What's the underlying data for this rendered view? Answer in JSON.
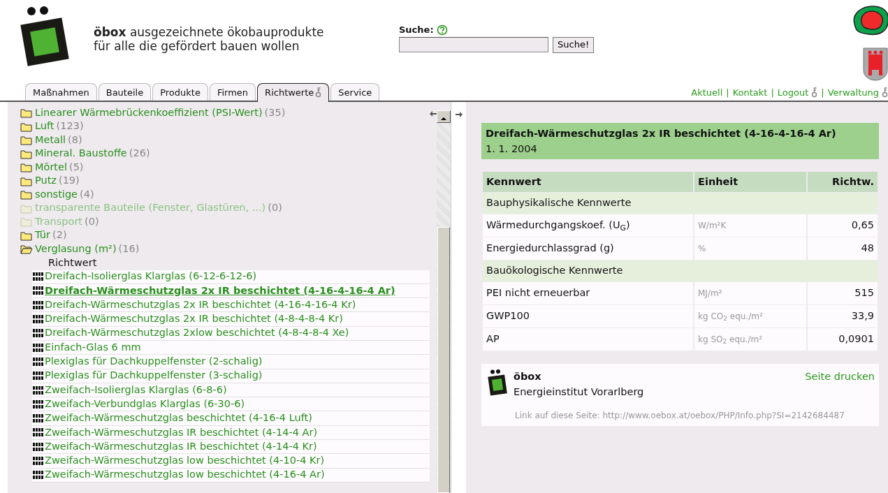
{
  "header": {
    "brand": "öbox",
    "tagline": "ausgezeichnete ökobauprodukte",
    "tagline_2": "für alle die gefördert bauen wollen"
  },
  "search": {
    "label": "Suche:",
    "button": "Suche!"
  },
  "tabs": [
    {
      "label": "Maßnahmen",
      "selected": false,
      "locked": false
    },
    {
      "label": "Bauteile",
      "selected": false,
      "locked": false
    },
    {
      "label": "Produkte",
      "selected": false,
      "locked": false
    },
    {
      "label": "Firmen",
      "selected": false,
      "locked": false
    },
    {
      "label": "Richtwerte",
      "selected": true,
      "locked": true
    },
    {
      "label": "Service",
      "selected": false,
      "locked": false
    }
  ],
  "top_links": {
    "separator": "|",
    "items": [
      {
        "label": "Aktuell",
        "locked": false
      },
      {
        "label": "Kontakt",
        "locked": false
      },
      {
        "label": "Logout",
        "locked": true
      },
      {
        "label": "Verwaltung",
        "locked": true
      }
    ]
  },
  "tree": [
    {
      "label": "Linearer Wärmebrückenkoeffizient (PSI-Wert)",
      "count": "(35)",
      "empty": false,
      "expanded": false
    },
    {
      "label": "Luft",
      "count": "(123)",
      "empty": false,
      "expanded": false
    },
    {
      "label": "Metall",
      "count": "(8)",
      "empty": false,
      "expanded": false
    },
    {
      "label": "Mineral. Baustoffe",
      "count": "(26)",
      "empty": false,
      "expanded": false
    },
    {
      "label": "Mörtel",
      "count": "(5)",
      "empty": false,
      "expanded": false
    },
    {
      "label": "Putz",
      "count": "(19)",
      "empty": false,
      "expanded": false
    },
    {
      "label": "sonstige",
      "count": "(4)",
      "empty": false,
      "expanded": false
    },
    {
      "label": "transparente Bauteile (Fenster, Glastüren, ...)",
      "count": "(0)",
      "empty": true,
      "expanded": false
    },
    {
      "label": "Transport",
      "count": "(0)",
      "empty": true,
      "expanded": false
    },
    {
      "label": "Tür",
      "count": "(2)",
      "empty": false,
      "expanded": false
    },
    {
      "label": "Verglasung (m²)",
      "count": "(16)",
      "empty": false,
      "expanded": true,
      "children_heading": "Richtwert",
      "children": [
        {
          "label": "Dreifach-Isolierglas Klarglas (6-12-6-12-6)",
          "selected": false
        },
        {
          "label": "Dreifach-Wärmeschutzglas 2x IR beschichtet (4-16-4-16-4 Ar)",
          "selected": true
        },
        {
          "label": "Dreifach-Wärmeschutzglas 2x IR beschichtet (4-16-4-16-4 Kr)",
          "selected": false
        },
        {
          "label": "Dreifach-Wärmeschutzglas 2x IR beschichtet (4-8-4-8-4 Kr)",
          "selected": false
        },
        {
          "label": "Dreifach-Wärmeschutzglas 2xlow beschichtet (4-8-4-8-4 Xe)",
          "selected": false
        },
        {
          "label": "Einfach-Glas 6 mm",
          "selected": false
        },
        {
          "label": "Plexiglas für Dachkuppelfenster (2-schalig)",
          "selected": false
        },
        {
          "label": "Plexiglas für Dachkuppelfenster (3-schalig)",
          "selected": false
        },
        {
          "label": "Zweifach-Isolierglas Klarglas (6-8-6)",
          "selected": false
        },
        {
          "label": "Zweifach-Verbundglas Klarglas (6-30-6)",
          "selected": false
        },
        {
          "label": "Zweifach-Wärmeschutzglas beschichtet (4-16-4 Luft)",
          "selected": false
        },
        {
          "label": "Zweifach-Wärmeschutzglas IR beschichtet (4-14-4 Ar)",
          "selected": false
        },
        {
          "label": "Zweifach-Wärmeschutzglas IR beschichtet (4-14-4 Kr)",
          "selected": false
        },
        {
          "label": "Zweifach-Wärmeschutzglas low beschichtet (4-10-4 Kr)",
          "selected": false
        },
        {
          "label": "Zweifach-Wärmeschutzglas low beschichtet (4-16-4 Ar)",
          "selected": false
        }
      ]
    }
  ],
  "detail": {
    "title": "Dreifach-Wärmeschutzglas 2x IR beschichtet (4-16-4-16-4 Ar)",
    "date": "1. 1. 2004",
    "columns": [
      "Kennwert",
      "Einheit",
      "Richtw."
    ],
    "rows": [
      {
        "kind": "section",
        "name": "Bauphysikalische Kennwerte"
      },
      {
        "kind": "value",
        "name": "Wärmedurchgangskoef. (U$_{G}$)",
        "unit": "W/m²K",
        "value": "0,65"
      },
      {
        "kind": "value",
        "name": "Energiedurchlassgrad (g)",
        "unit": "%",
        "value": "48"
      },
      {
        "kind": "section",
        "name": "Bauökologische Kennwerte"
      },
      {
        "kind": "value",
        "name": "PEI nicht erneuerbar",
        "unit": "MJ/m²",
        "value": "515"
      },
      {
        "kind": "value",
        "name": "GWP100",
        "unit": "kg CO$_{2}$ equ./m²",
        "value": "33,9"
      },
      {
        "kind": "value",
        "name": "AP",
        "unit": "kg SO$_{2}$ equ./m²",
        "value": "0,0901"
      }
    ]
  },
  "footer_card": {
    "brand": "öbox",
    "org": "Energieinstitut Vorarlberg",
    "print_link": "Seite drucken",
    "page_link": "Link auf diese Seite: http://www.oebox.at/oebox/PHP/Info.php?SI=2142684487"
  }
}
